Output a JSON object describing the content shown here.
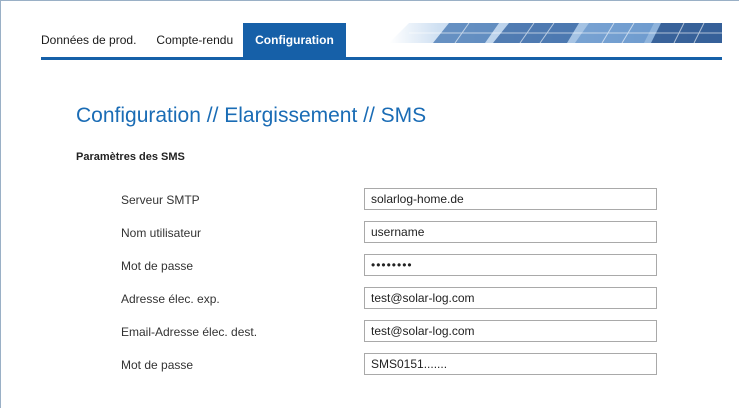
{
  "tabs": [
    {
      "label": "Données de prod.",
      "active": false
    },
    {
      "label": "Compte-rendu",
      "active": false
    },
    {
      "label": "Configuration",
      "active": true
    }
  ],
  "page": {
    "title": "Configuration // Elargissement // SMS",
    "section_title": "Paramètres des SMS"
  },
  "form": {
    "rows": [
      {
        "label": "Serveur SMTP",
        "value": "solarlog-home.de",
        "type": "text"
      },
      {
        "label": "Nom utilisateur",
        "value": "username",
        "type": "text"
      },
      {
        "label": "Mot de passe",
        "value": "password",
        "type": "password"
      },
      {
        "label": "Adresse élec. exp.",
        "value": "test@solar-log.com",
        "type": "text"
      },
      {
        "label": "Email-Adresse élec. dest.",
        "value": "test@solar-log.com",
        "type": "text"
      },
      {
        "label": "Mot de passe",
        "value": "SMS0151.......",
        "type": "text"
      }
    ]
  },
  "colors": {
    "accent": "#1660a8",
    "title": "#1a6cb5"
  },
  "banner_icon": "solar-panel-banner"
}
